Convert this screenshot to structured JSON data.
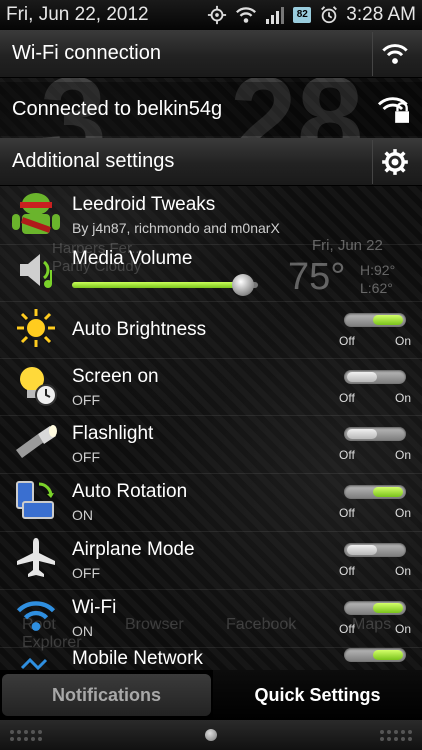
{
  "status_bar": {
    "date": "Fri, Jun 22, 2012",
    "time": "3:28 AM",
    "icons": [
      "gps-icon",
      "wifi-icon",
      "signal-icon",
      "bluetooth-82-icon",
      "alarm-icon"
    ],
    "bt_badge": "82"
  },
  "wallpaper": {
    "clock_left": "3",
    "clock_right": "28",
    "location": "Harpers Fer...",
    "condition": "Partly Cloudy",
    "weather_date": "Fri, Jun 22",
    "temp": "75°",
    "high": "H:92°",
    "low": "L:62°",
    "dock": [
      "Root Explorer",
      "Browser",
      "Facebook",
      "Maps"
    ]
  },
  "headers": {
    "wifi_connection": "Wi-Fi connection",
    "connected": "Connected to belkin54g",
    "additional": "Additional settings"
  },
  "tweaks": {
    "title": "Leedroid Tweaks",
    "sub": "By j4n87, richmondo and m0narX"
  },
  "media_volume": {
    "title": "Media Volume",
    "level": 0.92
  },
  "toggle_off_label": "Off",
  "toggle_on_label": "On",
  "toggles": [
    {
      "title": "Auto Brightness",
      "sub": "",
      "state": "on"
    },
    {
      "title": "Screen on",
      "sub": "OFF",
      "state": "off"
    },
    {
      "title": "Flashlight",
      "sub": "OFF",
      "state": "off"
    },
    {
      "title": "Auto Rotation",
      "sub": "ON",
      "state": "on"
    },
    {
      "title": "Airplane Mode",
      "sub": "OFF",
      "state": "off"
    },
    {
      "title": "Wi-Fi",
      "sub": "ON",
      "state": "on"
    },
    {
      "title": "Mobile Network",
      "sub": "",
      "state": "on"
    }
  ],
  "tabs": {
    "notifications": "Notifications",
    "quick_settings": "Quick Settings"
  },
  "colors": {
    "toggle_on": "#8ed42a",
    "active_tab_bg": "#000000"
  }
}
